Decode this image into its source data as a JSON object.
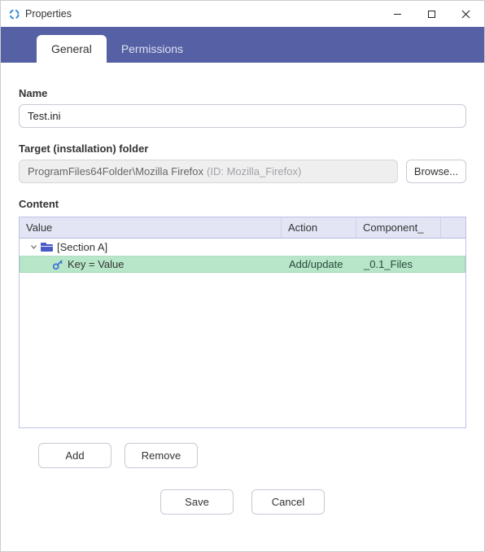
{
  "window": {
    "title": "Properties"
  },
  "tabs": {
    "general": "General",
    "permissions": "Permissions"
  },
  "labels": {
    "name": "Name",
    "target": "Target (installation) folder",
    "content": "Content"
  },
  "name": {
    "value": "Test.ini"
  },
  "target": {
    "path": "ProgramFiles64Folder\\Mozilla Firefox",
    "hint": "(ID: Mozilla_Firefox)"
  },
  "buttons": {
    "browse": "Browse...",
    "add": "Add",
    "remove": "Remove",
    "save": "Save",
    "cancel": "Cancel"
  },
  "grid": {
    "headers": {
      "value": "Value",
      "action": "Action",
      "component": "Component_"
    },
    "section": {
      "label": "[Section A]"
    },
    "row": {
      "value": "Key = Value",
      "action": "Add/update",
      "component": "_0.1_Files"
    }
  }
}
